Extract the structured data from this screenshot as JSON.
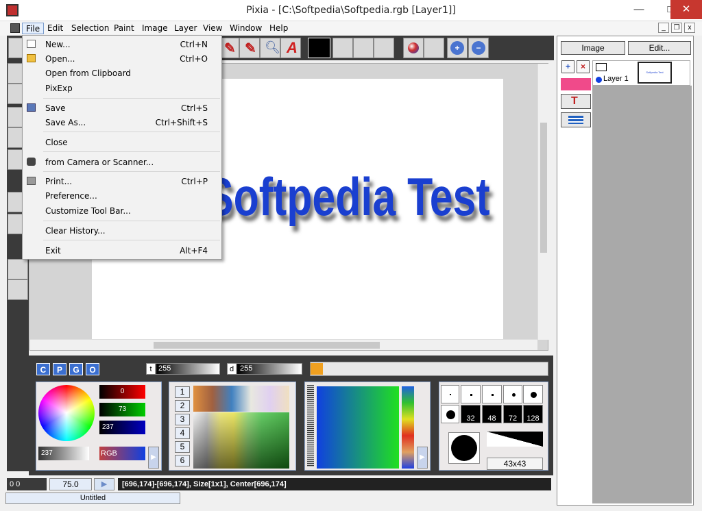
{
  "window": {
    "title": "Pixia - [C:\\Softpedia\\Softpedia.rgb [Layer1]]",
    "minimize": "—",
    "maximize": "□",
    "close": "✕"
  },
  "menubar": [
    "File",
    "Edit",
    "Selection",
    "Paint",
    "Image",
    "Layer",
    "View",
    "Window",
    "Help"
  ],
  "file_menu": {
    "items": [
      {
        "label": "New...",
        "shortcut": "Ctrl+N",
        "icon": "new-file-icon"
      },
      {
        "label": "Open...",
        "shortcut": "Ctrl+O",
        "icon": "folder-icon"
      },
      {
        "label": "Open from Clipboard",
        "shortcut": "",
        "icon": ""
      },
      {
        "label": "PixExp",
        "shortcut": "",
        "icon": ""
      },
      {
        "label": "Save",
        "shortcut": "Ctrl+S",
        "icon": "save-icon"
      },
      {
        "label": "Save As...",
        "shortcut": "Ctrl+Shift+S",
        "icon": ""
      },
      {
        "label": "Close",
        "shortcut": "",
        "icon": ""
      },
      {
        "label": "from Camera or Scanner...",
        "shortcut": "",
        "icon": "camera-icon"
      },
      {
        "label": "Print...",
        "shortcut": "Ctrl+P",
        "icon": "printer-icon"
      },
      {
        "label": "Preference...",
        "shortcut": "",
        "icon": ""
      },
      {
        "label": "Customize Tool Bar...",
        "shortcut": "",
        "icon": ""
      },
      {
        "label": "Clear History...",
        "shortcut": "",
        "icon": ""
      },
      {
        "label": "Exit",
        "shortcut": "Alt+F4",
        "icon": ""
      }
    ]
  },
  "canvas": {
    "text": "Softpedia Test",
    "text_color": "#1a3fd0"
  },
  "brush_panel": {
    "modes": [
      "C",
      "P",
      "G",
      "O"
    ],
    "t_label": "t",
    "t_value": "255",
    "d_label": "d",
    "d_value": "255"
  },
  "color_panel": {
    "red_value": "0",
    "green_value": "73",
    "blue_value": "237",
    "gray_value": "237",
    "mode": "RGB"
  },
  "palette_numbers": [
    "1",
    "2",
    "3",
    "4",
    "5",
    "6"
  ],
  "brush_sizes": [
    "32",
    "48",
    "72",
    "128"
  ],
  "brush_size_display": "43x43",
  "status": {
    "coord": "0 0",
    "zoom": "75.0",
    "info": "[696,174]-[696,174], Size[1x1], Center[696,174]",
    "document_tab": "Untitled"
  },
  "layers_panel": {
    "image_tab": "Image",
    "edit_tab": "Edit...",
    "layer_name": "Layer 1",
    "thumbnail_text": "Softpedia Test"
  },
  "colors": {
    "accent": "#3b6fd0",
    "close": "#c7372f",
    "dark_panel": "#3a3a3a"
  }
}
